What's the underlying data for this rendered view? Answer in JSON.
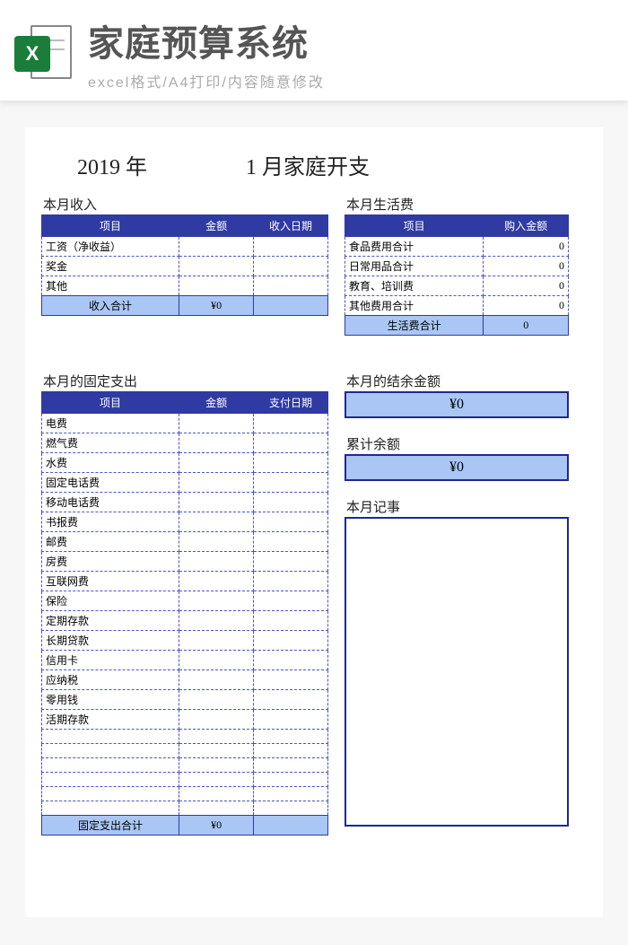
{
  "banner": {
    "badge": "X",
    "title": "家庭预算系统",
    "subtitle": "excel格式/A4打印/内容随意修改"
  },
  "title": {
    "year_part": "2019  年",
    "month_part": "1 月家庭开支"
  },
  "income": {
    "label": "本月收入",
    "headers": [
      "项目",
      "金额",
      "收入日期"
    ],
    "rows": [
      "工资（净收益）",
      "奖金",
      "其他"
    ],
    "total_label": "收入合计",
    "total_value": "¥0"
  },
  "living": {
    "label": "本月生活费",
    "headers": [
      "项目",
      "购入金额"
    ],
    "rows": [
      {
        "name": "食品费用合计",
        "value": "0"
      },
      {
        "name": "日常用品合计",
        "value": "0"
      },
      {
        "name": "教育、培训费",
        "value": "0"
      },
      {
        "name": "其他费用合计",
        "value": "0"
      }
    ],
    "total_label": "生活费合计",
    "total_value": "0"
  },
  "fixed": {
    "label": "本月的固定支出",
    "headers": [
      "项目",
      "金额",
      "支付日期"
    ],
    "rows": [
      "电费",
      "燃气费",
      "水费",
      "固定电话费",
      "移动电话费",
      "书报费",
      "邮费",
      "房费",
      "互联网费",
      "保险",
      "定期存款",
      "长期贷款",
      "信用卡",
      "应纳税",
      "零用钱",
      "活期存款"
    ],
    "blank_rows": 6,
    "total_label": "固定支出合计",
    "total_value": "¥0"
  },
  "balance": {
    "remain_label": "本月的结余金额",
    "remain_value": "¥0",
    "cumulative_label": "累计余额",
    "cumulative_value": "¥0",
    "notes_label": "本月记事"
  }
}
